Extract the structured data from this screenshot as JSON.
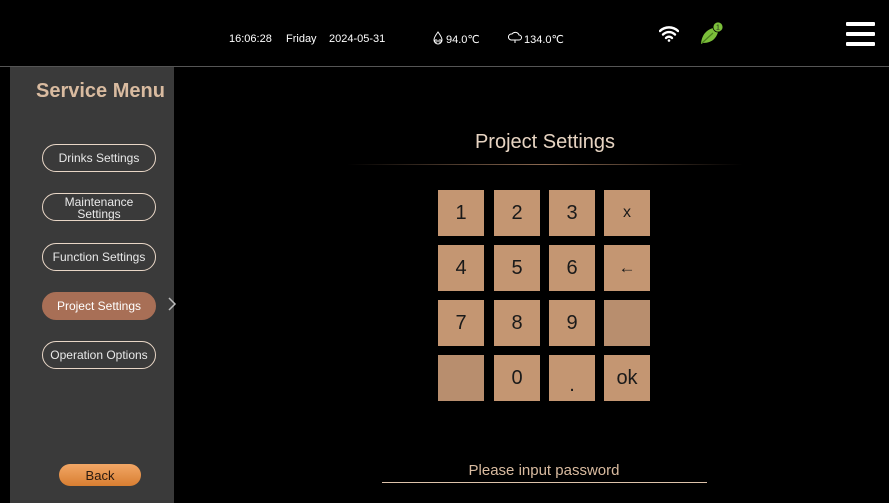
{
  "status_bar": {
    "time": "16:06:28",
    "day": "Friday",
    "date": "2024-05-31",
    "temp1": "94.0℃",
    "temp2": "134.0℃",
    "notification_count": "1"
  },
  "sidebar": {
    "title": "Service Menu",
    "items": [
      {
        "label": "Drinks Settings"
      },
      {
        "label": "Maintenance Settings"
      },
      {
        "label": "Function Settings"
      },
      {
        "label": "Project Settings",
        "active": true
      },
      {
        "label": "Operation Options"
      }
    ],
    "back_label": "Back"
  },
  "main": {
    "title": "Project Settings",
    "keypad": {
      "k1": "1",
      "k2": "2",
      "k3": "3",
      "kx": "x",
      "k4": "4",
      "k5": "5",
      "k6": "6",
      "kback": "←",
      "k7": "7",
      "k8": "8",
      "k9": "9",
      "kblank1": "",
      "kblank2": "",
      "k0": "0",
      "kdot": ".",
      "kok": "ok"
    },
    "password_prompt": "Please input password"
  },
  "colors": {
    "accent": "#a86f56",
    "key": "#c49672",
    "title": "#d9bba0",
    "back_button": "#e8923f",
    "leaf": "#7bbf3a"
  },
  "icons": [
    "drop-temp-icon",
    "steam-temp-icon",
    "wifi-icon",
    "leaf-icon",
    "hamburger-menu-icon",
    "chevron-right-icon"
  ]
}
